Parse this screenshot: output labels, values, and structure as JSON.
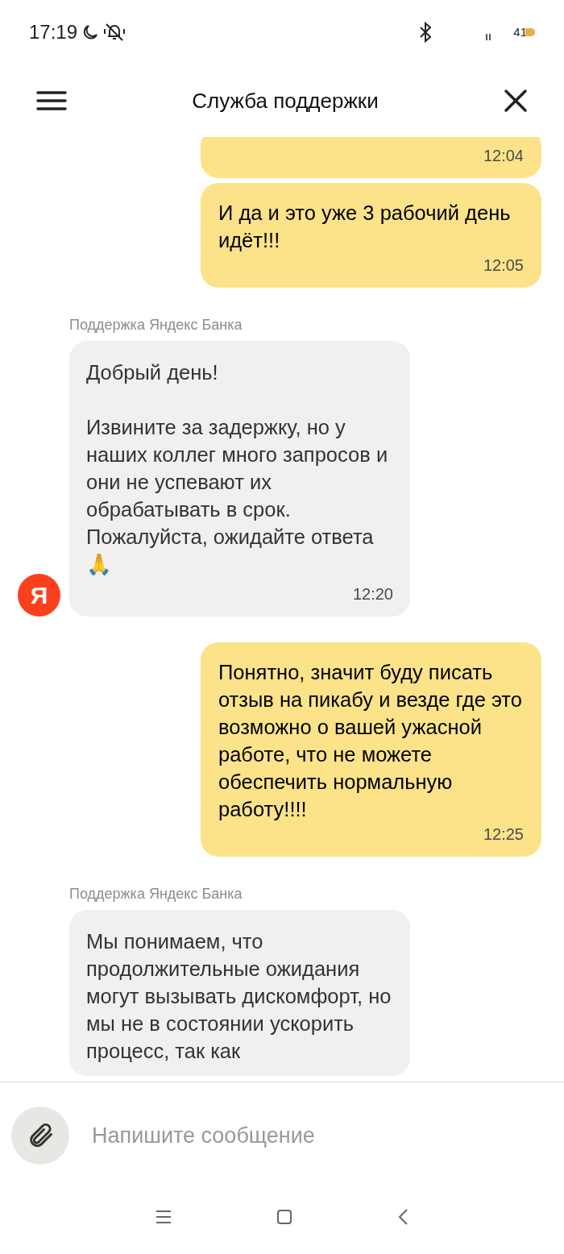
{
  "status_bar": {
    "time": "17:19",
    "battery": "41"
  },
  "header": {
    "title": "Служба поддержки"
  },
  "messages": [
    {
      "kind": "outgoing",
      "time": "12:04"
    },
    {
      "kind": "outgoing",
      "text": "И да и это уже 3 рабочий день идёт!!!",
      "time": "12:05"
    },
    {
      "kind": "incoming",
      "sender": "Поддержка Яндекс Банка",
      "avatar": "Я",
      "text": "Добрый день!\n\nИзвините за задержку, но у наших коллег много запросов и они не успевают их обрабатывать в срок. Пожалуйста, ожидайте ответа 🙏",
      "time": "12:20"
    },
    {
      "kind": "outgoing",
      "text": "Понятно, значит буду писать отзыв на пикабу и везде где это возможно о вашей ужасной работе, что не можете обеспечить нормальную работу!!!!",
      "time": "12:25"
    },
    {
      "kind": "incoming",
      "sender": "Поддержка Яндекс Банка",
      "text": "Мы понимаем, что продолжительные ожидания могут вызывать дискомфорт, но мы не в состоянии ускорить процесс, так как"
    }
  ],
  "composer": {
    "placeholder": "Напишите сообщение"
  }
}
